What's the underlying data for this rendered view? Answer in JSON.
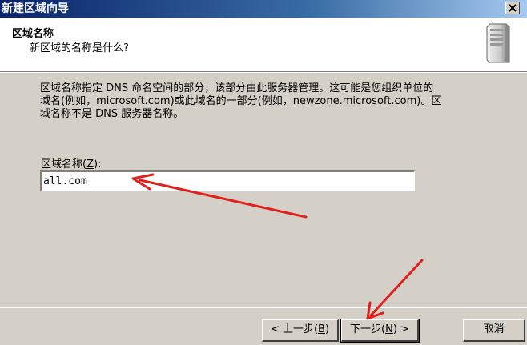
{
  "window": {
    "title": "新建区域向导",
    "close_glyph": "✕"
  },
  "header": {
    "title": "区域名称",
    "subtitle": "新区域的名称是什么?",
    "icon": "server-icon"
  },
  "body": {
    "description_lines": [
      "区域名称指定 DNS 命名空间的部分，该部分由此服务器管理。这可能是您组织单位的",
      "域名(例如，microsoft.com)或此域名的一部分(例如，newzone.microsoft.com)。区",
      "域名称不是 DNS 服务器名称。"
    ],
    "zone_name_label": "区域名称(",
    "zone_name_accel": "Z",
    "zone_name_label_end": "):",
    "zone_name_value": "all.com"
  },
  "buttons": {
    "back_label": "< 上一步(",
    "back_accel": "B",
    "back_end": ")",
    "next_label": "下一步(",
    "next_accel": "N",
    "next_end": ") >",
    "cancel_label": "取消"
  },
  "annotations": {
    "arrow_color": "#e0201c"
  }
}
